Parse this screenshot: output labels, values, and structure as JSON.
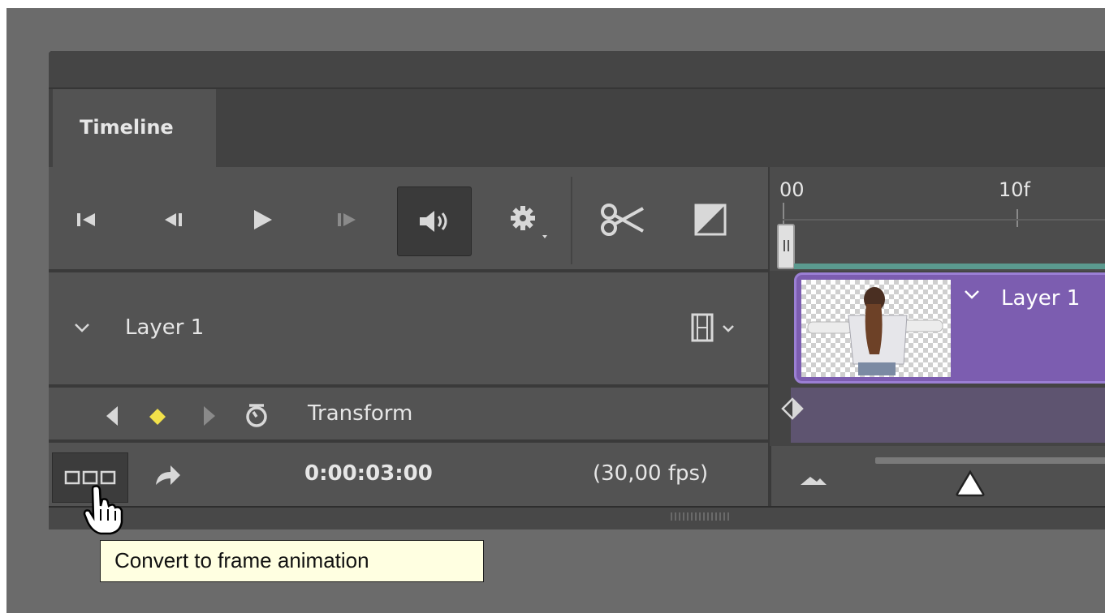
{
  "panel": {
    "tab_label": "Timeline"
  },
  "layer": {
    "name": "Layer 1"
  },
  "property": {
    "name": "Transform"
  },
  "status": {
    "timecode": "0:00:03:00",
    "fps": "(30,00 fps)"
  },
  "ruler": {
    "tick_start": "00",
    "tick_10": "10f"
  },
  "clip": {
    "label": "Layer 1"
  },
  "tooltip": {
    "text": "Convert to frame animation"
  },
  "icons": {
    "go_first": "go-to-first-frame-icon",
    "prev_frame": "previous-frame-icon",
    "play": "play-icon",
    "next_frame": "next-frame-icon",
    "audio": "speaker-icon",
    "settings": "gear-icon",
    "split": "scissors-icon",
    "transition": "transition-icon",
    "film": "film-strip-icon",
    "keyframe_nav": "keyframe-diamond-icon",
    "stopwatch": "stopwatch-icon",
    "frame_animation": "frame-animation-icon",
    "render": "render-arrow-icon",
    "zoom_out": "mountain-small-icon",
    "cursor": "hand-cursor-icon"
  },
  "colors": {
    "clip_fill": "#7c5db0",
    "keyframe_active": "#f2e14a",
    "work_area": "#5b9a8f",
    "tooltip_bg": "#ffffe1"
  }
}
